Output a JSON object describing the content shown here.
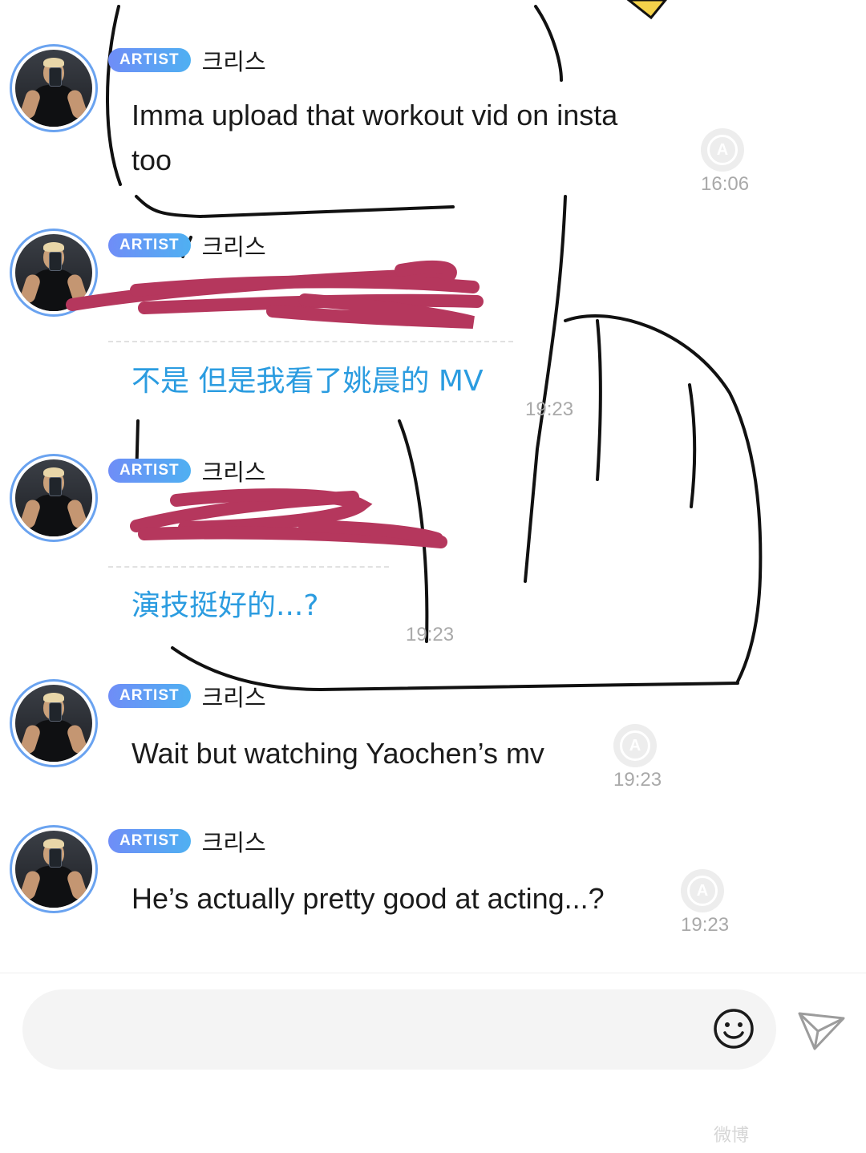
{
  "messages": [
    {
      "badge": "ARTIST",
      "sender": "크리스",
      "text_lines": [
        "Imma upload that workout vid on insta",
        "too"
      ],
      "time": "16:06",
      "translate_icon_letter": "A"
    },
    {
      "badge": "ARTIST",
      "sender": "크리스",
      "translation": "不是 但是我看了姚晨的 MV",
      "time": "19:23"
    },
    {
      "badge": "ARTIST",
      "sender": "크리스",
      "translation": "演技挺好的...?",
      "time": "19:23"
    },
    {
      "badge": "ARTIST",
      "sender": "크리스",
      "text": "Wait but watching Yaochen’s mv",
      "time": "19:23",
      "translate_icon_letter": "A"
    },
    {
      "badge": "ARTIST",
      "sender": "크리스",
      "text": "He’s actually pretty good at acting...?",
      "time": "19:23",
      "translate_icon_letter": "A"
    }
  ],
  "input": {
    "placeholder": ""
  },
  "icons": {
    "emoji": "smiley-icon",
    "send": "paper-plane-icon",
    "translate": "translate-icon"
  },
  "colors": {
    "badge_start": "#6f8df7",
    "badge_end": "#4fb0f2",
    "translation": "#2b9ce0",
    "redaction": "#b5375d"
  },
  "watermark": "微博"
}
